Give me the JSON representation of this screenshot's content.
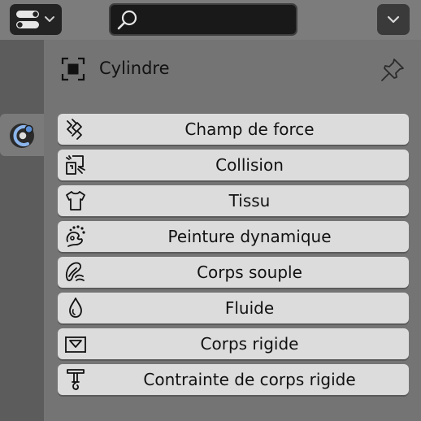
{
  "header": {
    "editor_type_icon": "properties-editor-icon",
    "search": {
      "value": "",
      "placeholder": ""
    },
    "menu_icon": "chevron-down-icon"
  },
  "tabs": [
    {
      "name": "physics",
      "icon": "physics-icon",
      "active": true
    }
  ],
  "object": {
    "name": "Cylindre",
    "icon": "object-icon",
    "pin_icon": "pin-icon"
  },
  "physics_buttons": [
    {
      "label": "Champ de force",
      "icon": "force-field-icon"
    },
    {
      "label": "Collision",
      "icon": "collision-icon"
    },
    {
      "label": "Tissu",
      "icon": "cloth-icon"
    },
    {
      "label": "Peinture dynamique",
      "icon": "dynamic-paint-icon"
    },
    {
      "label": "Corps souple",
      "icon": "soft-body-icon"
    },
    {
      "label": "Fluide",
      "icon": "fluid-icon"
    },
    {
      "label": "Corps rigide",
      "icon": "rigid-body-icon"
    },
    {
      "label": "Contrainte de corps rigide",
      "icon": "rigid-body-constraint-icon"
    }
  ],
  "colors": {
    "header_bg": "#7c7c7c",
    "panel_bg": "#747474",
    "button_bg": "#dcdcdc",
    "active_tab_accent": "#5a8fd6"
  }
}
